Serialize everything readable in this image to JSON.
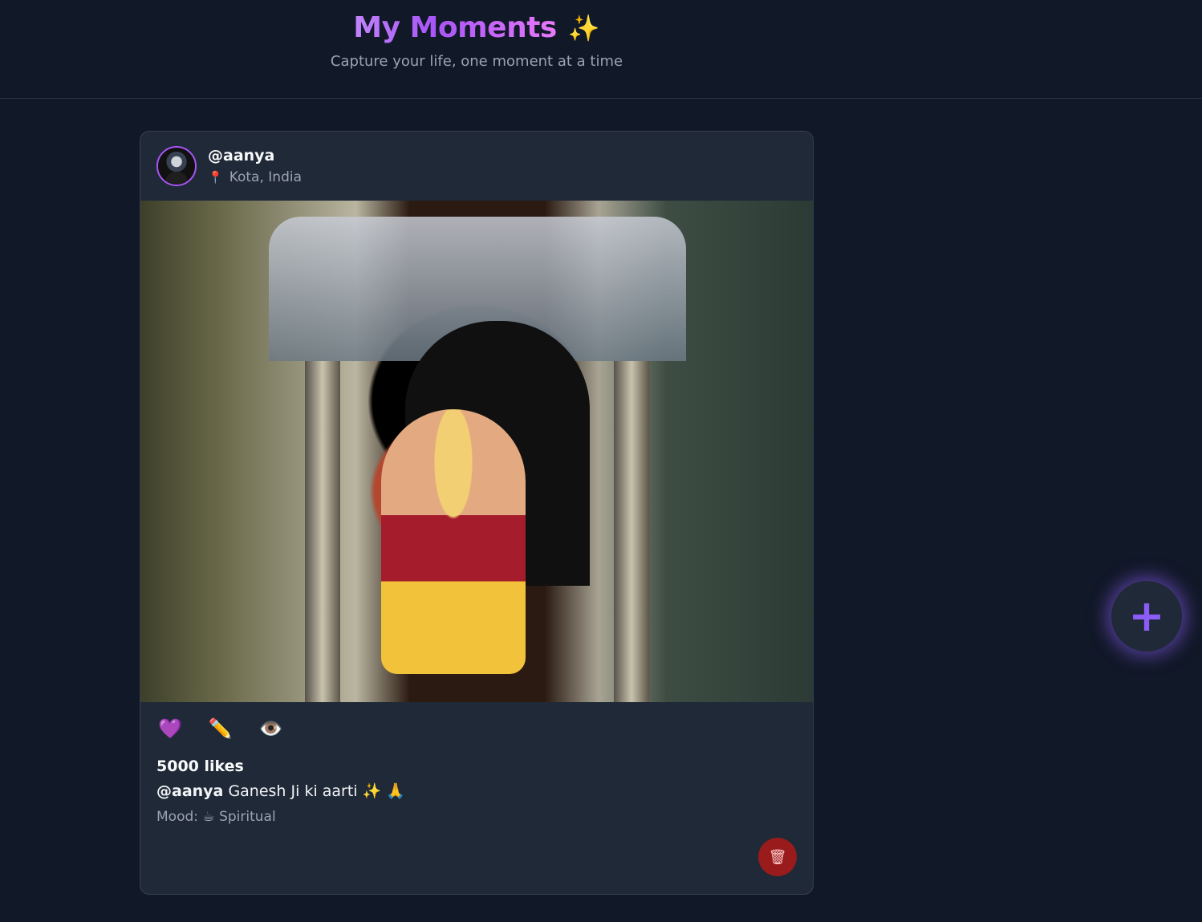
{
  "header": {
    "title": "My Moments",
    "title_emoji": "✨",
    "subtitle": "Capture your life, one moment at a time"
  },
  "post": {
    "username": "@aanya",
    "location": "Kota, India",
    "location_icon": "pin-icon",
    "likes_text": "5000 likes",
    "caption_user": "@aanya",
    "caption_text": "Ganesh Ji ki aarti ✨ 🙏",
    "mood_label": "Mood:",
    "mood_icon": "☕",
    "mood_value": "Spiritual",
    "actions": [
      {
        "icon": "heart-icon",
        "glyph": "💜"
      },
      {
        "icon": "pencil-icon",
        "glyph": "✏️"
      },
      {
        "icon": "eye-icon",
        "glyph": "👁️"
      }
    ],
    "delete_glyph": "🗑"
  },
  "fab": {
    "glyph": "+"
  },
  "colors": {
    "background": "#111827",
    "card": "#1f2937",
    "accent": "#a855f7",
    "delete": "#991b1b"
  }
}
